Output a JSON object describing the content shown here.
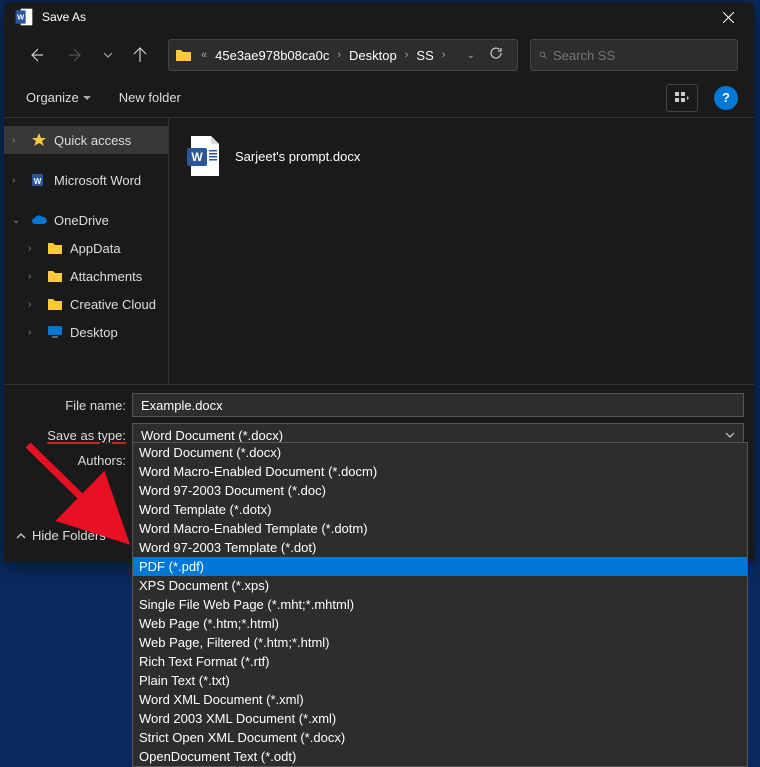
{
  "title": "Save As",
  "path": {
    "prefix": "«",
    "segments": [
      "45e3ae978b08ca0c",
      "Desktop",
      "SS"
    ]
  },
  "search": {
    "placeholder": "Search SS"
  },
  "toolbar": {
    "organize": "Organize",
    "new_folder": "New folder"
  },
  "sidebar": {
    "quick_access": "Quick access",
    "microsoft_word": "Microsoft Word",
    "onedrive": "OneDrive",
    "children": [
      "AppData",
      "Attachments",
      "Creative Cloud",
      "Desktop"
    ]
  },
  "files": [
    {
      "name": "Sarjeet's prompt.docx"
    }
  ],
  "form": {
    "file_name_label": "File name:",
    "file_name_value": "Example.docx",
    "save_type_label": "Save as type:",
    "save_type_value": "Word Document (*.docx)",
    "authors_label": "Authors:"
  },
  "hide_folders": "Hide Folders",
  "dropdown_options": [
    "Word Document (*.docx)",
    "Word Macro-Enabled Document (*.docm)",
    "Word 97-2003 Document (*.doc)",
    "Word Template (*.dotx)",
    "Word Macro-Enabled Template (*.dotm)",
    "Word 97-2003 Template (*.dot)",
    "PDF (*.pdf)",
    "XPS Document (*.xps)",
    "Single File Web Page (*.mht;*.mhtml)",
    "Web Page (*.htm;*.html)",
    "Web Page, Filtered (*.htm;*.html)",
    "Rich Text Format (*.rtf)",
    "Plain Text (*.txt)",
    "Word XML Document (*.xml)",
    "Word 2003 XML Document (*.xml)",
    "Strict Open XML Document (*.docx)",
    "OpenDocument Text (*.odt)"
  ],
  "dropdown_selected_index": 6
}
